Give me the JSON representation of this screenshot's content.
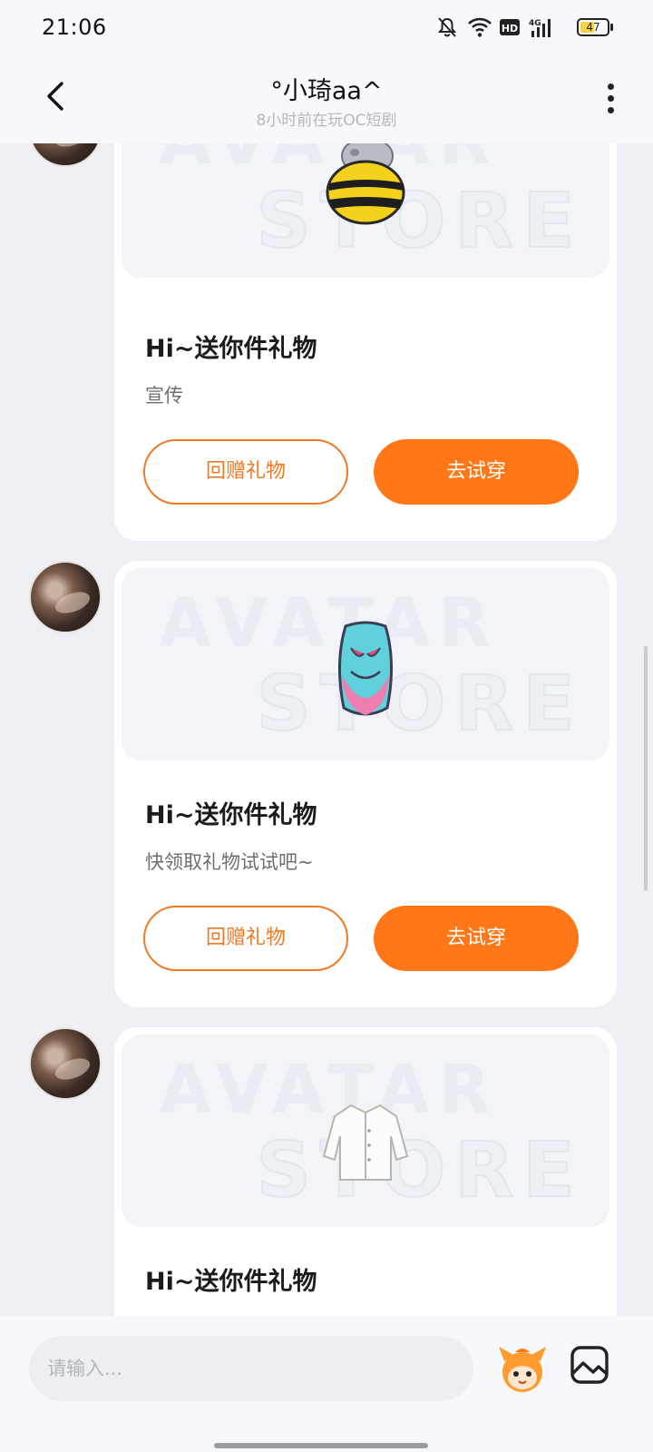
{
  "status_bar": {
    "time": "21:06",
    "battery_level": "47",
    "icons": [
      "bell-off-icon",
      "wifi-icon",
      "hd-icon",
      "signal-4g-icon",
      "battery-icon"
    ]
  },
  "header": {
    "title": "°小琦aa^",
    "subtitle": "8小时前在玩OC短剧"
  },
  "watermark": {
    "line1": "AVATAR",
    "line2": "STORE"
  },
  "messages": [
    {
      "gift_item": "bee-costume-icon",
      "title": "Hi~送你件礼物",
      "desc": "宣传",
      "return_label": "回赠礼物",
      "try_label": "去试穿"
    },
    {
      "gift_item": "mask-skirt-icon",
      "title": "Hi~送你件礼物",
      "desc": "快领取礼物试试吧~",
      "return_label": "回赠礼物",
      "try_label": "去试穿"
    },
    {
      "gift_item": "white-jacket-icon",
      "title": "Hi~送你件礼物"
    }
  ],
  "input": {
    "placeholder": "请输入..."
  },
  "colors": {
    "accent": "#ff7716",
    "outline": "#f07a24",
    "background": "#eef0f6"
  }
}
